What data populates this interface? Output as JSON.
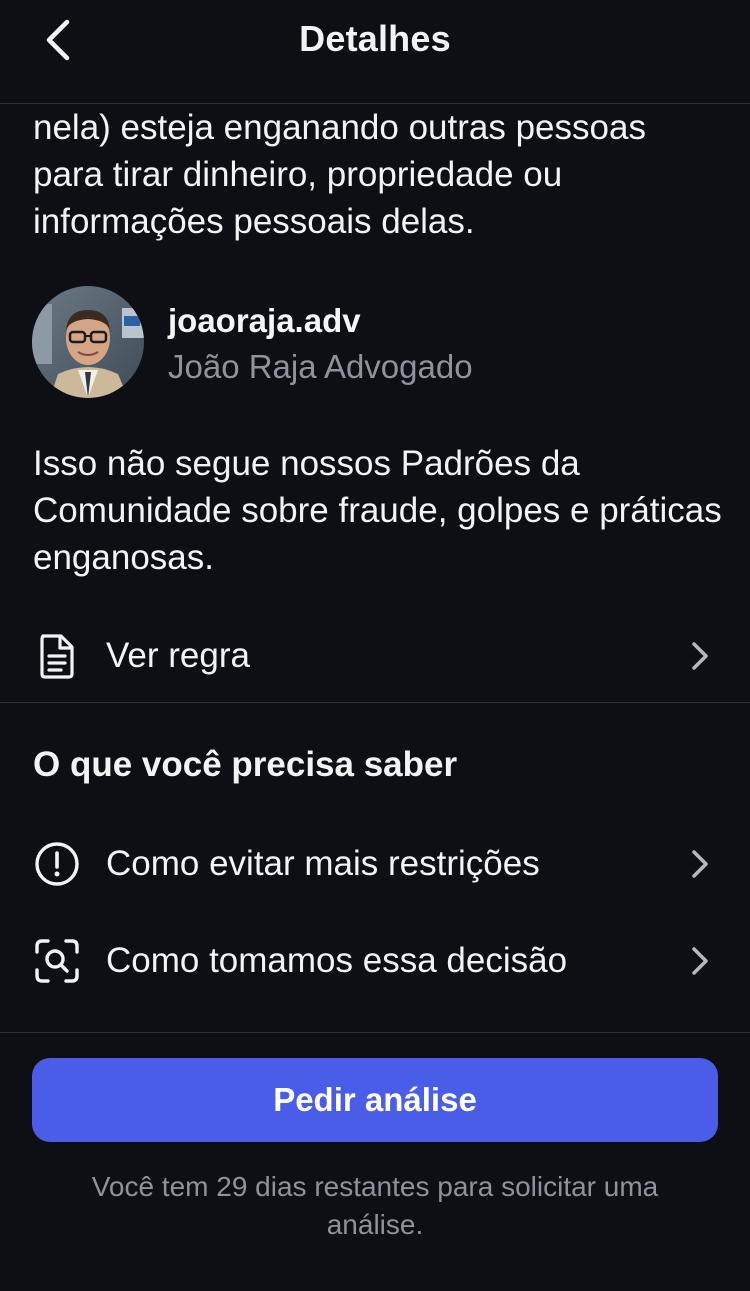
{
  "header": {
    "title": "Detalhes",
    "back_icon": "chevron-left-icon"
  },
  "lead_text": "nela) esteja enganando outras pessoas para tirar dinheiro, propriedade ou informações pessoais delas.",
  "account": {
    "username": "joaoraja.adv",
    "display_name": "João Raja Advogado"
  },
  "policy_text": "Isso não segue nossos Padrões da Comunidade sobre fraude, golpes e práticas enganosas.",
  "rule_row": {
    "label": "Ver regra",
    "icon": "document-icon"
  },
  "section": {
    "title": "O que você precisa saber",
    "items": [
      {
        "label": "Como evitar mais restrições",
        "icon": "alert-circle-icon"
      },
      {
        "label": "Como tomamos essa decisão",
        "icon": "scan-search-icon"
      }
    ]
  },
  "cta": {
    "label": "Pedir análise",
    "color": "#4a5de8"
  },
  "footnote": "Você tem 29 dias restantes para solicitar uma análise.",
  "colors": {
    "background": "#0d0f14",
    "text": "#f2f3f5",
    "muted": "#8e929b",
    "divider": "#2b2e34"
  }
}
